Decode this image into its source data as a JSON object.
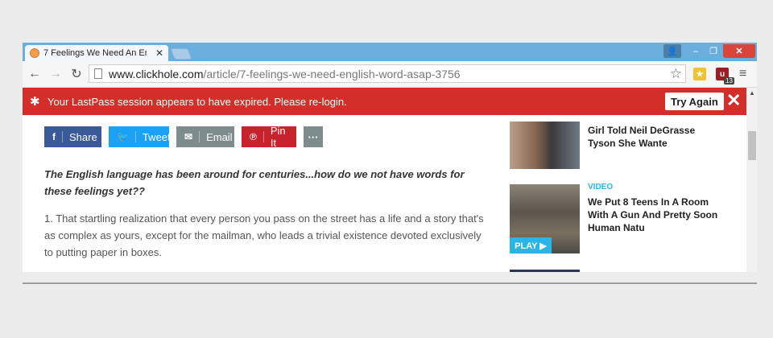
{
  "tab": {
    "title": "7 Feelings We Need An En",
    "close": "✕"
  },
  "window_controls": {
    "user": "👤",
    "minimize": "–",
    "maximize": "❐",
    "close": "✕"
  },
  "toolbar": {
    "back": "←",
    "forward": "→",
    "reload": "↻",
    "url_host": "www.clickhole.com",
    "url_path": "/article/7-feelings-we-need-english-word-asap-3756",
    "star": "☆",
    "ublock_badge": "13",
    "menu": "≡"
  },
  "lastpass": {
    "message": "Your LastPass session appears to have expired. Please re-login.",
    "try_again": "Try Again",
    "close": "✕",
    "color": "#d32e2a"
  },
  "share": {
    "facebook": {
      "icon": "f",
      "label": "Share"
    },
    "twitter": {
      "icon": "🐦",
      "label": "Tweet"
    },
    "email": {
      "icon": "✉",
      "label": "Email"
    },
    "pinterest": {
      "icon": "℗",
      "label": "Pin It"
    },
    "more": "···"
  },
  "article": {
    "lede": "The English language has been around for centuries...how do we not have words for these feelings yet??",
    "item1": "1. That startling realization that every person you pass on the street has a life and a story that's as complex as yours, except for the mailman, who leads a trivial existence devoted exclusively to putting paper in boxes."
  },
  "sidebar": {
    "item1_title": "Girl Told Neil DeGrasse Tyson She Wante",
    "item2_category": "VIDEO",
    "item2_title": "We Put 8 Teens In A Room With A Gun And Pretty Soon Human Natu",
    "play_label": "PLAY ▶",
    "accent": "#2ab5e6"
  }
}
